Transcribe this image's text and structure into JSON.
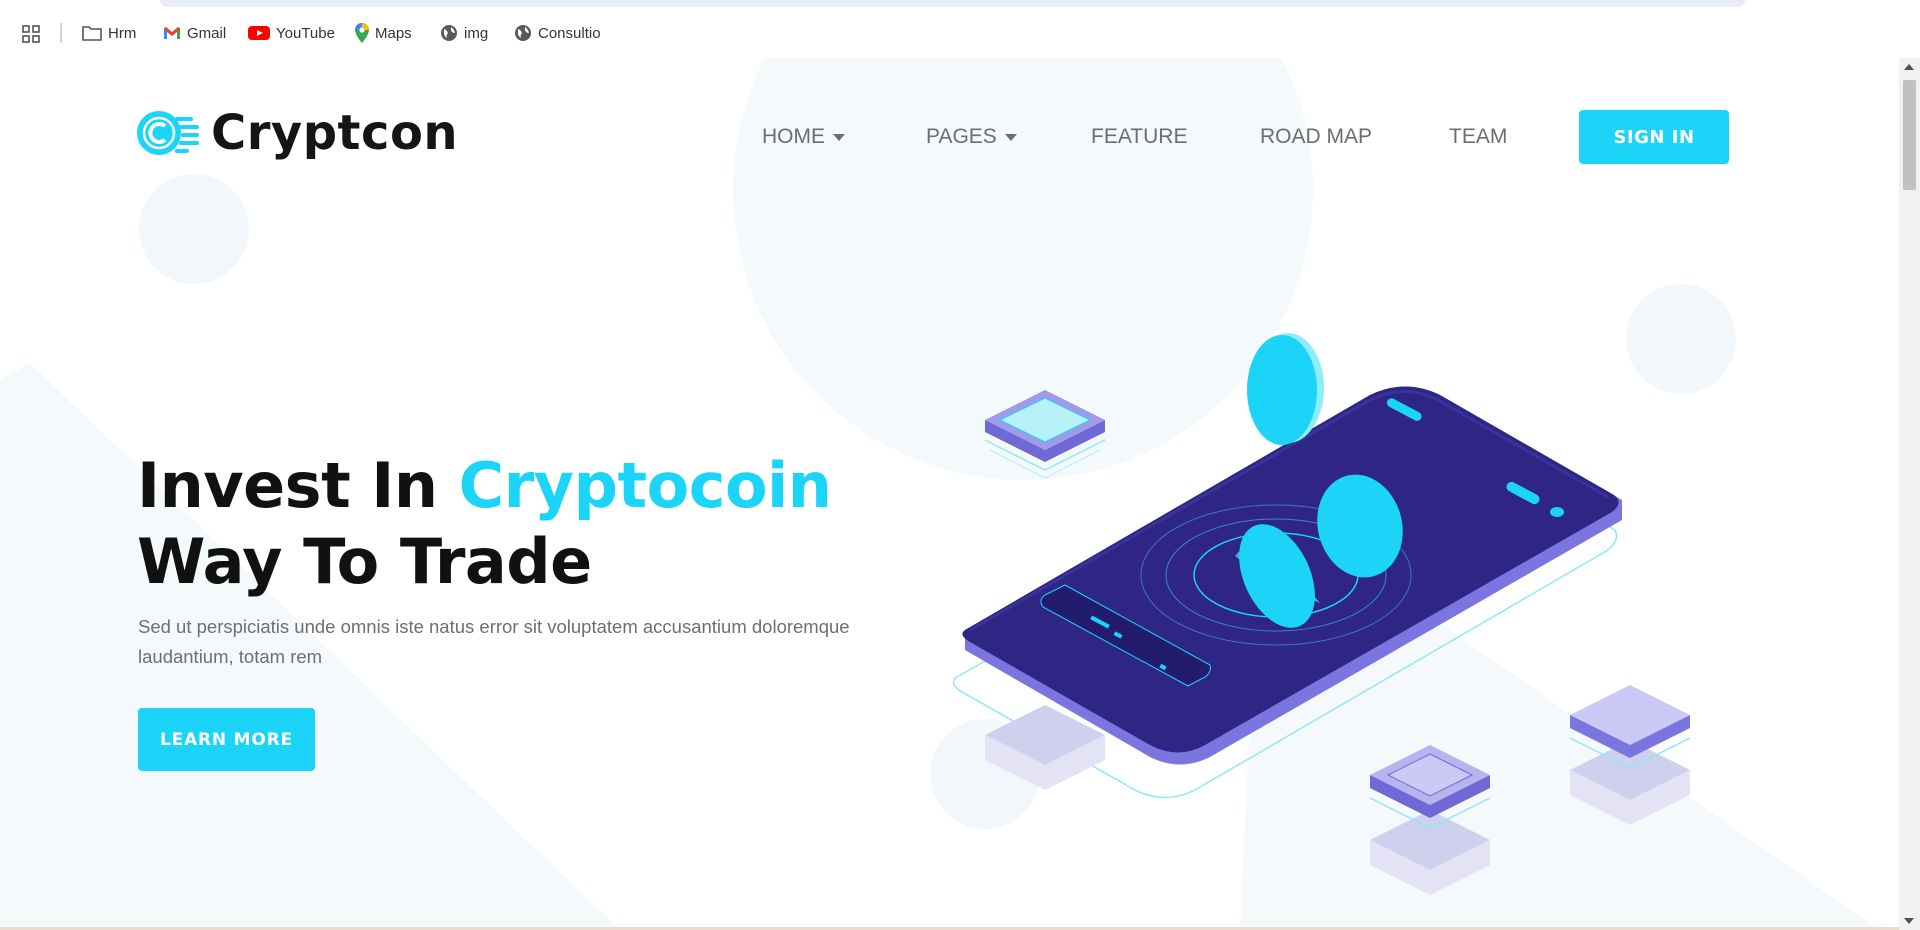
{
  "bookmarks": {
    "apps_icon": "apps-grid-icon",
    "items": [
      {
        "label": "Hrm",
        "icon": "folder-icon"
      },
      {
        "label": "Gmail",
        "icon": "gmail-icon"
      },
      {
        "label": "YouTube",
        "icon": "youtube-icon"
      },
      {
        "label": "Maps",
        "icon": "maps-pin-icon"
      },
      {
        "label": "img",
        "icon": "globe-icon"
      },
      {
        "label": "Consultio",
        "icon": "globe-icon"
      }
    ]
  },
  "header": {
    "logo_text": "Cryptcon",
    "nav": [
      {
        "label": "HOME",
        "dropdown": true
      },
      {
        "label": "PAGES",
        "dropdown": true
      },
      {
        "label": "FEATURE",
        "dropdown": false
      },
      {
        "label": "ROAD MAP",
        "dropdown": false
      },
      {
        "label": "TEAM",
        "dropdown": false
      }
    ],
    "signin_label": "SIGN IN"
  },
  "hero": {
    "title_part1": "Invest In ",
    "title_accent": "Cryptocoin",
    "title_line2": "Way To Trade",
    "description": "Sed ut perspiciatis unde omnis iste natus error sit voluptatem accusantium doloremque laudantium, totam rem",
    "button_label": "LEARN MORE"
  },
  "colors": {
    "accent": "#1cd4f8",
    "dark_text": "#111111",
    "nav_text": "#6d6d6d",
    "phone_purple": "#2b2380"
  }
}
